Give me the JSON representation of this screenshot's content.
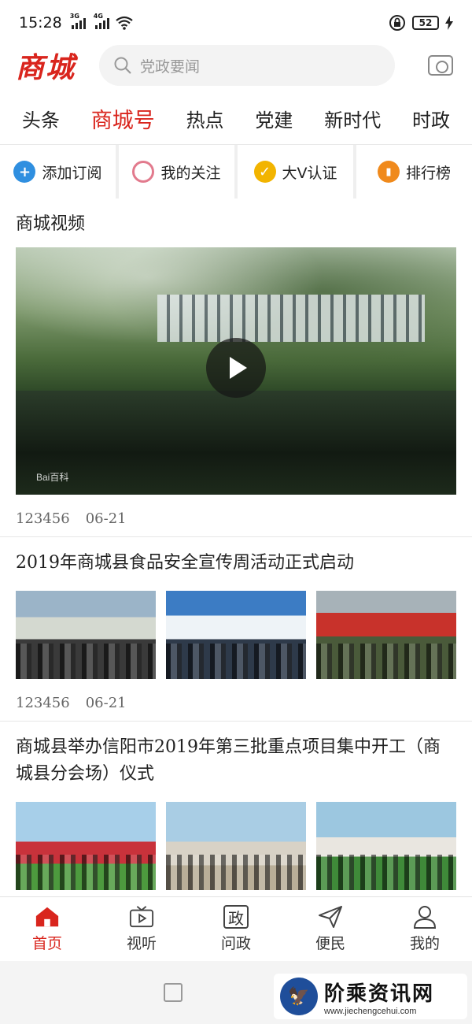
{
  "status": {
    "time": "15:28",
    "net1": "3G",
    "net2": "4G",
    "battery": "52"
  },
  "header": {
    "logo": "商城",
    "search_placeholder": "党政要闻"
  },
  "tabs": [
    "头条",
    "商城号",
    "热点",
    "党建",
    "新时代",
    "时政"
  ],
  "active_tab": 1,
  "quick_actions": [
    {
      "label": "添加订阅",
      "icon": "plus-circle-icon",
      "color": "#2f8fe0"
    },
    {
      "label": "我的关注",
      "icon": "ring-circle-icon",
      "color": "#e27a8d"
    },
    {
      "label": "大V认证",
      "icon": "v-badge-icon",
      "color": "#f2b400"
    },
    {
      "label": "排行榜",
      "icon": "ranking-icon",
      "color": "#f08a1c"
    }
  ],
  "feed": [
    {
      "title": "商城视频",
      "views": "123456",
      "date": "06-21",
      "watermark": "Bai百科"
    },
    {
      "title": "2019年商城县食品安全宣传周活动正式启动",
      "views": "123456",
      "date": "06-21"
    },
    {
      "title": "商城县举办信阳市2019年第三批重点项目集中开工（商城县分会场）仪式"
    }
  ],
  "bottom_nav": [
    {
      "label": "首页",
      "icon": "home-icon"
    },
    {
      "label": "视听",
      "icon": "tv-icon"
    },
    {
      "label": "问政",
      "icon": "zheng-icon",
      "glyph": "政"
    },
    {
      "label": "便民",
      "icon": "send-icon"
    },
    {
      "label": "我的",
      "icon": "user-icon"
    }
  ],
  "watermark": {
    "title": "阶乘资讯网",
    "url": "www.jiechengcehui.com"
  },
  "colors": {
    "brand_red": "#d9251d"
  }
}
